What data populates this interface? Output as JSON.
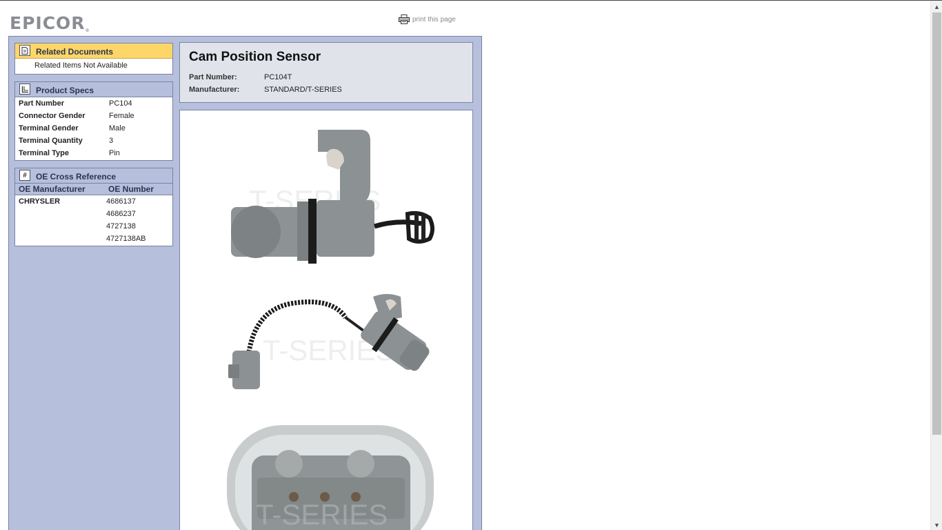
{
  "header": {
    "logo_text": "EPICOR",
    "logo_mark": "®",
    "print_label": "print this page"
  },
  "related_documents": {
    "title": "Related Documents",
    "message": "Related Items Not Available"
  },
  "product_specs": {
    "title": "Product Specs",
    "rows": [
      {
        "label": "Part Number",
        "value": "PC104"
      },
      {
        "label": "Connector Gender",
        "value": "Female"
      },
      {
        "label": "Terminal Gender",
        "value": "Male"
      },
      {
        "label": "Terminal Quantity",
        "value": "3"
      },
      {
        "label": "Terminal Type",
        "value": "Pin"
      }
    ]
  },
  "oe_cross_reference": {
    "title": "OE Cross Reference",
    "col_manufacturer": "OE Manufacturer",
    "col_number": "OE Number",
    "rows": [
      {
        "manufacturer": "CHRYSLER",
        "number": "4686137"
      },
      {
        "manufacturer": "",
        "number": "4686237"
      },
      {
        "manufacturer": "",
        "number": "4727138"
      },
      {
        "manufacturer": "",
        "number": "4727138AB"
      }
    ]
  },
  "product": {
    "title": "Cam Position Sensor",
    "part_number_label": "Part Number:",
    "part_number": "PC104T",
    "manufacturer_label": "Manufacturer:",
    "manufacturer": "STANDARD/T-SERIES",
    "watermark": "T-SERIES"
  },
  "colors": {
    "panel_bg": "#b6bfdb",
    "header_yellow": "#fcd668",
    "sensor_gray": "#8c9193"
  }
}
